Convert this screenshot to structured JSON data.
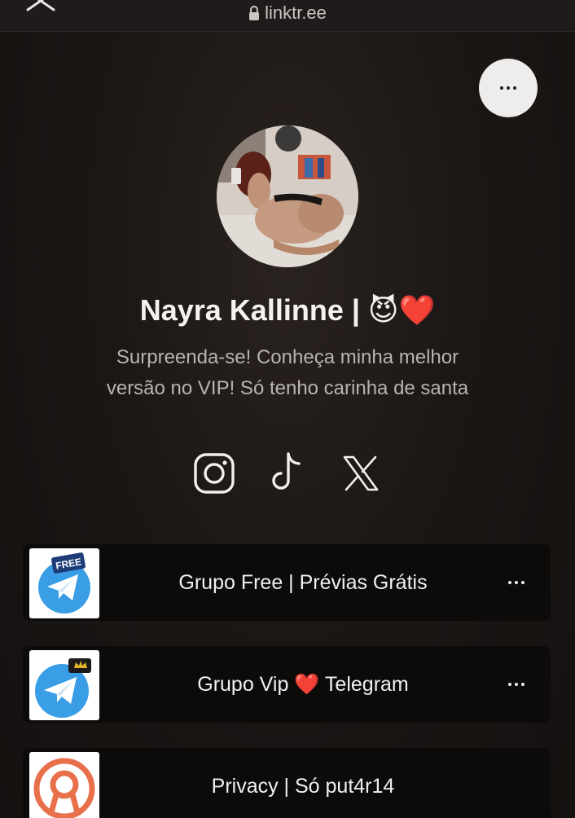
{
  "browser": {
    "url": "linktr.ee",
    "close_icon": "close-icon",
    "lock_icon": "lock-icon"
  },
  "profile": {
    "name": "Nayra Kallinne | 😈❤️",
    "bio_line1": "Surpreenda-se! Conheça minha melhor",
    "bio_line2": "versão no VIP! Só tenho carinha de santa",
    "avatar_icon": "profile-photo"
  },
  "socials": [
    {
      "icon": "instagram-icon"
    },
    {
      "icon": "tiktok-icon"
    },
    {
      "icon": "x-icon"
    }
  ],
  "links": [
    {
      "label": "Grupo Free | Prévias Grátis",
      "thumb": "telegram-free-icon",
      "badge": "FREE"
    },
    {
      "label": "Grupo Vip ❤️ Telegram",
      "thumb": "telegram-vip-icon"
    },
    {
      "label": "Privacy | Só put4r14",
      "thumb": "privacy-icon"
    }
  ],
  "colors": {
    "background": "#1c1715",
    "card": "#0d0b0a",
    "text": "#f2f0ef",
    "muted": "#b9b4b0",
    "telegram_blue": "#3a9ee6",
    "privacy_orange": "#e8704a"
  }
}
